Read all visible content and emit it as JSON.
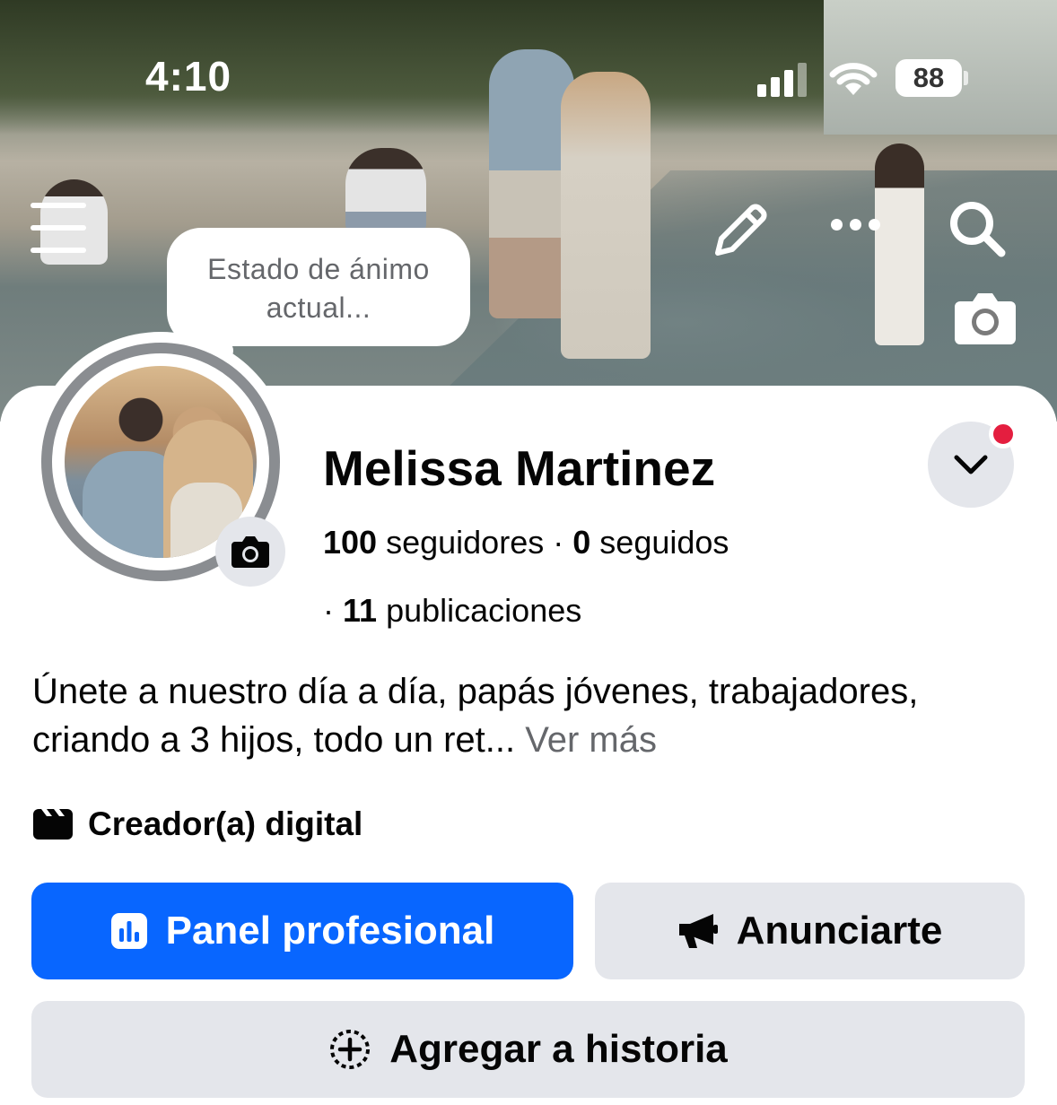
{
  "status_bar": {
    "time": "4:10",
    "battery": "88"
  },
  "cover": {
    "actions": [
      "menu-icon",
      "pencil-icon",
      "more-icon",
      "search-icon",
      "camera-icon"
    ]
  },
  "mood": {
    "placeholder_line1": "Estado de ánimo",
    "placeholder_line2": "actual..."
  },
  "profile": {
    "name": "Melissa Martinez",
    "followers_count": "100",
    "followers_label": "seguidores",
    "separator": "·",
    "following_count": "0",
    "following_label": "seguidos",
    "posts_count": "11",
    "posts_label": "publicaciones"
  },
  "bio": {
    "text": "Únete a nuestro día a día, papás jóvenes, trabajadores, criando a 3 hijos, todo un ret...",
    "see_more": "Ver más"
  },
  "category": {
    "label": "Creador(a) digital",
    "icon": "clapperboard-icon"
  },
  "buttons": {
    "dashboard": "Panel profesional",
    "advertise": "Anunciarte",
    "add_story": "Agregar a historia"
  },
  "colors": {
    "primary": "#0866ff",
    "secondary_bg": "#e4e6eb",
    "notification": "#e41e3f",
    "muted_text": "#65676b"
  }
}
